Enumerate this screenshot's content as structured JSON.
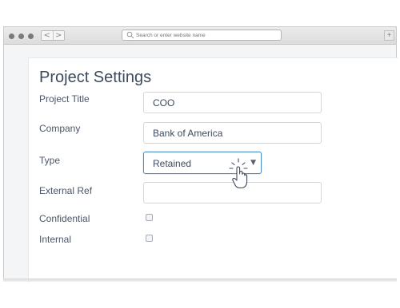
{
  "browser": {
    "address_placeholder": "Search or enter website name",
    "back_glyph": "<",
    "forward_glyph": ">",
    "new_tab_glyph": "+"
  },
  "page": {
    "title": "Project Settings"
  },
  "form": {
    "project_title": {
      "label": "Project Title",
      "value": "COO"
    },
    "company": {
      "label": "Company",
      "value": "Bank of America"
    },
    "type": {
      "label": "Type",
      "value": "Retained",
      "caret": "▼"
    },
    "external_ref": {
      "label": "External Ref",
      "value": ""
    },
    "confidential": {
      "label": "Confidential",
      "checked": false
    },
    "internal": {
      "label": "Internal",
      "checked": false
    }
  },
  "icons": [
    "window-dot-icon",
    "search-icon",
    "hand-cursor-icon",
    "chevron-down-icon"
  ],
  "colors": {
    "focus_border": "#4e8ec6",
    "text": "#3d4a5c",
    "chrome": "#dcdcdc"
  }
}
